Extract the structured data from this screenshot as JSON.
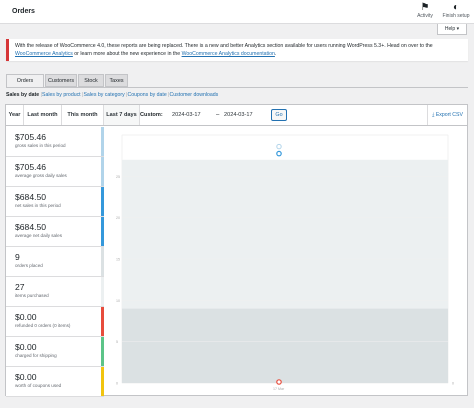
{
  "header": {
    "title": "Orders",
    "activity_label": "Activity",
    "finish_setup_label": "Finish setup",
    "help_label": "Help ▾"
  },
  "notice": {
    "text_before": "With the release of WooCommerce 4.0, these reports are being replaced. There is a new and better Analytics section available for users running WordPress 5.3+. Head on over to the ",
    "link1": "WooCommerce Analytics",
    "text_middle": " or learn more about the new experience in the ",
    "link2": "WooCommerce Analytics documentation",
    "text_after": "."
  },
  "tabs": [
    "Orders",
    "Customers",
    "Stock",
    "Taxes"
  ],
  "subnav": {
    "current": "Sales by date",
    "links": [
      "Sales by product",
      "Sales by category",
      "Coupons by date",
      "Customer downloads"
    ]
  },
  "ranges": {
    "year": "Year",
    "last_month": "Last month",
    "this_month": "This month",
    "last_7_days": "Last 7 days",
    "custom_label": "Custom:",
    "start_date": "2024-03-17",
    "end_date": "2024-03-17",
    "dash": "–",
    "go": "Go",
    "export": "Export CSV"
  },
  "legend": [
    {
      "value": "$705.46",
      "label": "gross sales in this period",
      "color": "#b1d4ea"
    },
    {
      "value": "$705.46",
      "label": "average gross daily sales",
      "color": "#b1d4ea"
    },
    {
      "value": "$684.50",
      "label": "net sales in this period",
      "color": "#3498db"
    },
    {
      "value": "$684.50",
      "label": "average net daily sales",
      "color": "#3498db"
    },
    {
      "value": "9",
      "label": "orders placed",
      "color": "#dbe1e3"
    },
    {
      "value": "27",
      "label": "items purchased",
      "color": "#ecf0f1"
    },
    {
      "value": "$0.00",
      "label": "refunded 0 orders (0 items)",
      "color": "#e74c3c"
    },
    {
      "value": "$0.00",
      "label": "charged for shipping",
      "color": "#5cc488"
    },
    {
      "value": "$0.00",
      "label": "worth of coupons used",
      "color": "#f1c40f"
    }
  ],
  "chart_data": {
    "type": "bar",
    "categories": [
      "17 Mar"
    ],
    "series": [
      {
        "values": [
          27
        ],
        "color": "#ecf0f1"
      },
      {
        "values": [
          9
        ],
        "color": "#dbe1e3"
      },
      {
        "values": [
          705.46
        ],
        "color": "#b1d4ea"
      },
      {
        "values": [
          684.5
        ],
        "color": "#3498db"
      },
      {
        "values": [
          0
        ],
        "color": "#e74c3c"
      }
    ],
    "y_left": {
      "ticks": [
        "0",
        "5",
        "10",
        "15",
        "20",
        "25",
        ""
      ],
      "ylim": [
        0,
        30
      ]
    },
    "y_right": {
      "ticks": [
        "0",
        "",
        "",
        "",
        "",
        "",
        "",
        "",
        "",
        "",
        ""
      ],
      "ylim": [
        0,
        740
      ]
    },
    "grid": true
  }
}
